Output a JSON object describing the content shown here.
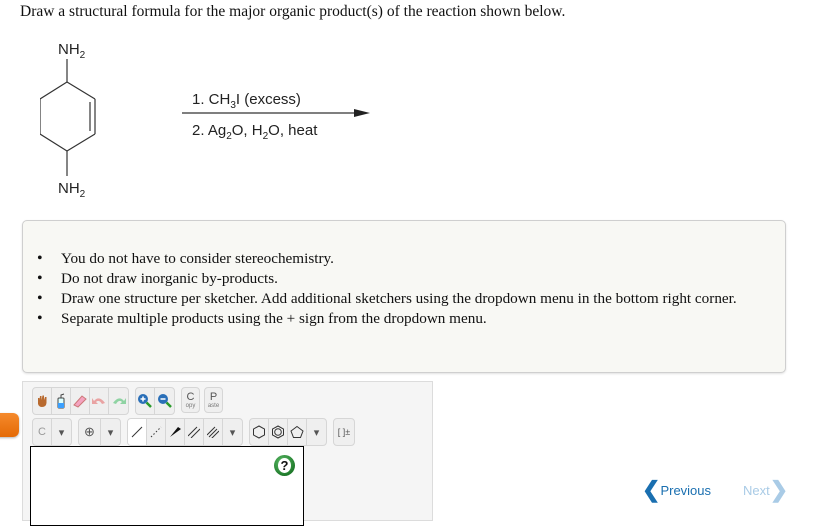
{
  "question": "Draw a structural formula for the major organic product(s) of the reaction shown below.",
  "reaction": {
    "reactant": "cyclohex-2-ene-1,4-diamine",
    "substituent_top": "NH",
    "substituent_top_sub": "2",
    "substituent_bottom": "NH",
    "substituent_bottom_sub": "2",
    "step1": "1. CH",
    "step1_sub": "3",
    "step1_rest": "I  (excess)",
    "step2_a": "2. Ag",
    "step2_sub1": "2",
    "step2_b": "O, H",
    "step2_sub2": "2",
    "step2_c": "O, heat"
  },
  "instructions": [
    "You do not have to consider stereochemistry.",
    "Do not draw inorganic by-products.",
    "Draw one structure per sketcher. Add additional sketchers using the dropdown menu in the bottom right corner.",
    "Separate multiple products using the + sign from the dropdown menu."
  ],
  "sketcher": {
    "toolbar_top": [
      {
        "name": "hand-icon",
        "label": "✋"
      },
      {
        "name": "wash-bottle-icon",
        "label": "🧴"
      },
      {
        "name": "eraser-icon",
        "label": "✎"
      },
      {
        "name": "undo-icon",
        "label": "↶"
      },
      {
        "name": "redo-icon",
        "label": "↷"
      },
      {
        "name": "zoom-in-icon",
        "label": "⊕"
      },
      {
        "name": "zoom-out-icon",
        "label": "⊖"
      }
    ],
    "copy_letter": "C",
    "copy_label": "opy",
    "paste_letter": "P",
    "paste_label": "aste",
    "element_label": "C",
    "charge_label": "⊕",
    "dropdown_glyph": "▾",
    "bracket_label": "[ ]±",
    "help_label": "?"
  },
  "navigation": {
    "previous": "Previous",
    "next": "Next",
    "prev_chevron": "❮",
    "next_chevron": "❯"
  },
  "colors": {
    "accent_orange": "#e46a06",
    "nav_active": "#1a6fb0",
    "nav_disabled": "#a9cbe6",
    "help_green": "#1f7a2b"
  }
}
